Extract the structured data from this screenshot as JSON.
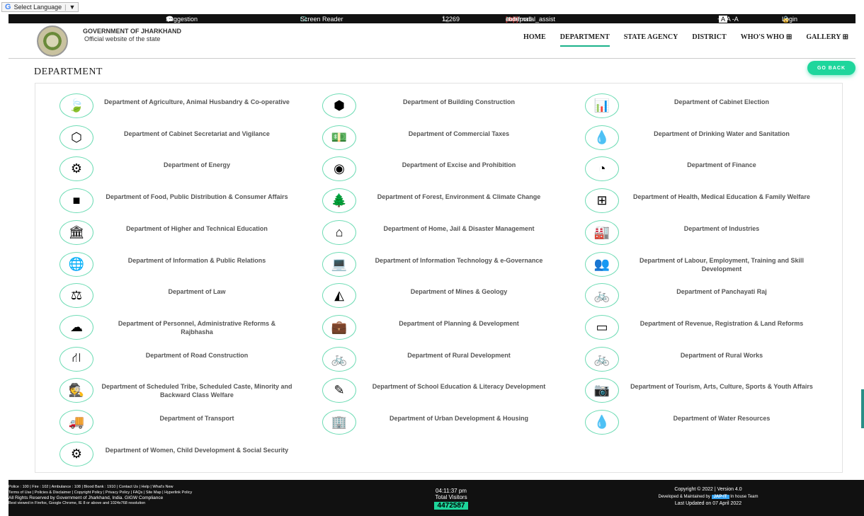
{
  "lang": {
    "label": "Select Language",
    "arrow": "▼"
  },
  "topbar": {
    "suggestion": "Suggestion",
    "screen_reader": "Screen Reader",
    "phone": "12269",
    "email_pre": "stateportal_assist",
    "email_at": "[at]",
    "email_mid": "rediffmail",
    "email_dot": "[dot]",
    "email_post": "com",
    "font_sizes": "+A A -A",
    "a1": "A",
    "a2": "A",
    "login": "Login"
  },
  "header": {
    "title": "GOVERNMENT OF JHARKHAND",
    "subtitle": "Official website of the state"
  },
  "nav": {
    "home": "HOME",
    "department": "DEPARTMENT",
    "state_agency": "STATE AGENCY",
    "district": "DISTRICT",
    "whos_who": "WHO'S WHO",
    "gallery": "GALLERY",
    "plus_icon": "⊞"
  },
  "page": {
    "title": "DEPARTMENT",
    "go_back": "GO BACK"
  },
  "departments": [
    {
      "label": "Department of Agriculture, Animal Husbandry & Co-operative",
      "icon": "leaf-icon",
      "glyph": "🍃"
    },
    {
      "label": "Department of Building Construction",
      "icon": "cubes-icon",
      "glyph": "⬢"
    },
    {
      "label": "Department of Cabinet Election",
      "icon": "bar-chart-icon",
      "glyph": "📊"
    },
    {
      "label": "Department of Cabinet Secretariat and Vigilance",
      "icon": "hexagon-icon",
      "glyph": "⬡"
    },
    {
      "label": "Department of Commercial Taxes",
      "icon": "money-icon",
      "glyph": "💵"
    },
    {
      "label": "Department of Drinking Water and Sanitation",
      "icon": "drop-icon",
      "glyph": "💧"
    },
    {
      "label": "Department of Energy",
      "icon": "cog-icon",
      "glyph": "⚙"
    },
    {
      "label": "Department of Excise and Prohibition",
      "icon": "dot-circle-icon",
      "glyph": "◉"
    },
    {
      "label": "Department of Finance",
      "icon": "pie-chart-icon",
      "glyph": "◔"
    },
    {
      "label": "Department of Food, Public Distribution & Consumer Affairs",
      "icon": "square-icon",
      "glyph": "■"
    },
    {
      "label": "Department of Forest, Environment & Climate Change",
      "icon": "tree-icon",
      "glyph": "🌲"
    },
    {
      "label": "Department of Health, Medical Education & Family Welfare",
      "icon": "medkit-icon",
      "glyph": "⊞"
    },
    {
      "label": "Department of Higher and Technical Education",
      "icon": "university-icon",
      "glyph": "🏛"
    },
    {
      "label": "Department of Home, Jail & Disaster Management",
      "icon": "home-icon",
      "glyph": "⌂"
    },
    {
      "label": "Department of Industries",
      "icon": "industry-icon",
      "glyph": "🏭"
    },
    {
      "label": "Department of Information & Public Relations",
      "icon": "globe-icon",
      "glyph": "🌐"
    },
    {
      "label": "Department of Information Technology & e-Governance",
      "icon": "laptop-icon",
      "glyph": "💻"
    },
    {
      "label": "Department of Labour, Employment, Training and Skill Development",
      "icon": "users-icon",
      "glyph": "👥"
    },
    {
      "label": "Department of Law",
      "icon": "balance-scale-icon",
      "glyph": "⚖"
    },
    {
      "label": "Department of Mines & Geology",
      "icon": "area-chart-icon",
      "glyph": "◭"
    },
    {
      "label": "Department of Panchayati Raj",
      "icon": "bicycle-icon",
      "glyph": "🚲"
    },
    {
      "label": "Department of Personnel, Administrative Reforms & Rajbhasha",
      "icon": "cloud-icon",
      "glyph": "☁"
    },
    {
      "label": "Department of Planning & Development",
      "icon": "briefcase-icon",
      "glyph": "💼"
    },
    {
      "label": "Department of Revenue, Registration & Land Reforms",
      "icon": "credit-card-icon",
      "glyph": "▭"
    },
    {
      "label": "Department of Road Construction",
      "icon": "road-icon",
      "glyph": "⛙"
    },
    {
      "label": "Department of Rural Development",
      "icon": "bicycle-icon",
      "glyph": "🚲"
    },
    {
      "label": "Department of Rural Works",
      "icon": "bicycle-icon",
      "glyph": "🚲"
    },
    {
      "label": "Department of Scheduled Tribe, Scheduled Caste, Minority and Backward Class Welfare",
      "icon": "user-secret-icon",
      "glyph": "🕵"
    },
    {
      "label": "Department of School Education & Literacy Development",
      "icon": "edit-icon",
      "glyph": "✎"
    },
    {
      "label": "Department of Tourism, Arts, Culture, Sports & Youth Affairs",
      "icon": "camera-icon",
      "glyph": "📷"
    },
    {
      "label": "Department of Transport",
      "icon": "truck-icon",
      "glyph": "🚚"
    },
    {
      "label": "Department of Urban Development & Housing",
      "icon": "building-icon",
      "glyph": "🏢"
    },
    {
      "label": "Department of Water Resources",
      "icon": "drop-icon",
      "glyph": "💧"
    },
    {
      "label": "Department of Women, Child Development & Social Security",
      "icon": "cogs-icon",
      "glyph": "⚙"
    }
  ],
  "footer": {
    "line1": "Police : 100 | Fire : 102 | Ambulance : 108 | Blood Bank : 1910 | Contact Us | Help | What's New",
    "line2": "Terms of Use | Policies & Disclaimer | Copyright Policy | Privacy Policy | FAQs | Site Map | Hyperlink Policy",
    "line3": "All Rights Reserved by Government of Jharkhand, India.  GIGW Compliance",
    "line4": "Best viewed in Firefox, Google Chrome, IE 8 or above and 1024x768 resolution",
    "time": "04:11:37 pm",
    "visitors_label": "Total Visitors",
    "visitors_count": "4472587",
    "copyright": "Copyright © 2022 |  Version 4.0",
    "maintained_pre": "Developed & Maintained by",
    "maintained_org": "JAP-IT",
    "maintained_post": "In house Team",
    "updated": "Last Updated on 07 April 2022"
  }
}
